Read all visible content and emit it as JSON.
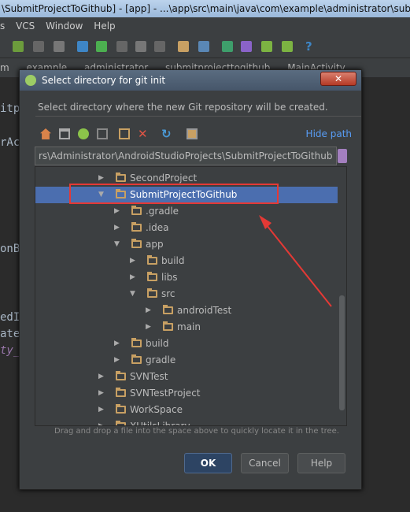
{
  "window": {
    "title": "\\SubmitProjectToGithub] - [app] - ...\\app\\src\\main\\java\\com\\example\\administrator\\subm"
  },
  "menu": [
    "s",
    "VCS",
    "Window",
    "Help"
  ],
  "breadcrumb": [
    "m",
    "example",
    "administrator",
    "submitprojecttogithub",
    "MainActivity"
  ],
  "editor_fragments": [
    "itp",
    "rAc",
    "onB",
    "edI",
    "ate",
    "ty_"
  ],
  "dialog": {
    "title": "Select directory for git init",
    "close_label": "✕",
    "description": "Select directory where the new Git repository will be created.",
    "toolbar_icons": [
      "home-icon",
      "desktop-icon",
      "android-project-icon",
      "module-icon",
      "new-folder-icon",
      "delete-icon",
      "refresh-icon",
      "show-hidden-icon"
    ],
    "hide_path": "Hide path",
    "path_value": "rs\\Administrator\\AndroidStudioProjects\\SubmitProjectToGithub",
    "tree": [
      {
        "label": "SecondProject",
        "level": 0,
        "expanded": false
      },
      {
        "label": "SubmitProjectToGithub",
        "level": 0,
        "expanded": true,
        "selected": true
      },
      {
        "label": ".gradle",
        "level": 1,
        "expanded": false
      },
      {
        "label": ".idea",
        "level": 1,
        "expanded": false
      },
      {
        "label": "app",
        "level": 1,
        "expanded": true
      },
      {
        "label": "build",
        "level": 2,
        "expanded": false
      },
      {
        "label": "libs",
        "level": 2,
        "expanded": false
      },
      {
        "label": "src",
        "level": 2,
        "expanded": true
      },
      {
        "label": "androidTest",
        "level": 3,
        "expanded": false
      },
      {
        "label": "main",
        "level": 3,
        "expanded": false
      },
      {
        "label": "build",
        "level": 1,
        "expanded": false
      },
      {
        "label": "gradle",
        "level": 1,
        "expanded": false
      },
      {
        "label": "SVNTest",
        "level": 0,
        "expanded": false
      },
      {
        "label": "SVNTestProject",
        "level": 0,
        "expanded": false
      },
      {
        "label": "WorkSpace",
        "level": 0,
        "expanded": false
      },
      {
        "label": "XUtilsLibrary",
        "level": 0,
        "expanded": false
      }
    ],
    "hint": "Drag and drop a file into the space above to quickly locate it in the tree.",
    "ok": "OK",
    "cancel": "Cancel",
    "help": "Help"
  },
  "colors": {
    "selection": "#4b6eaf",
    "annotation": "#e53935",
    "link": "#589df6"
  }
}
